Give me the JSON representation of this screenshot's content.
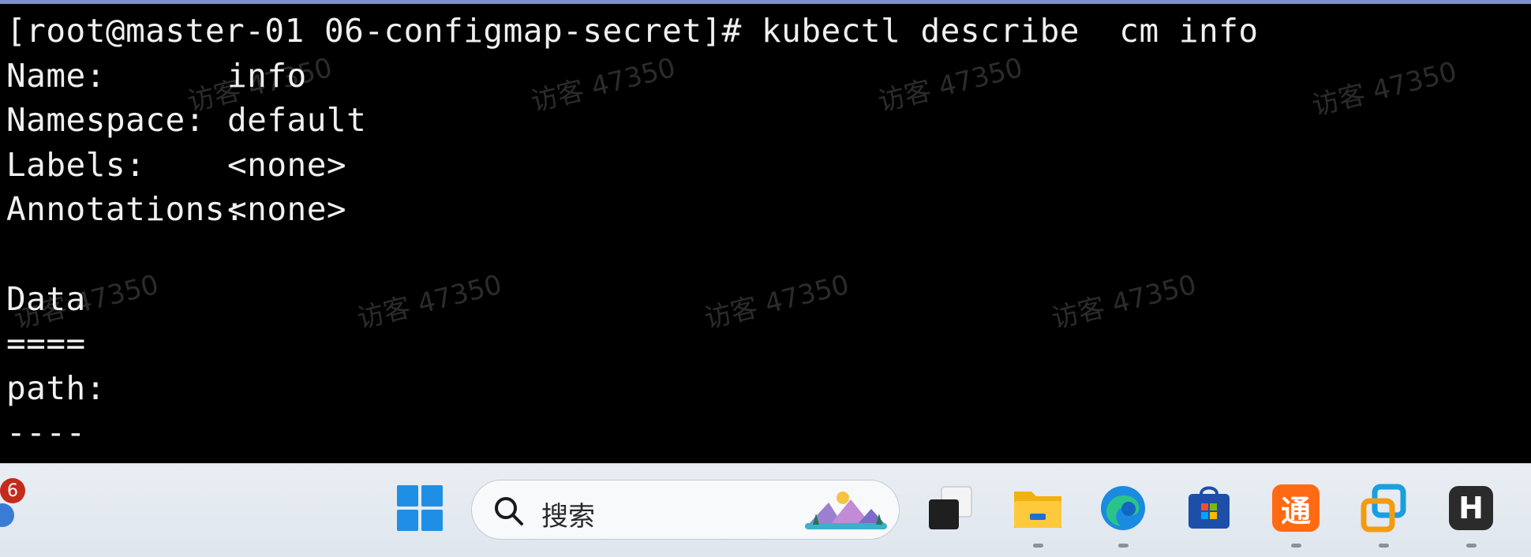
{
  "terminal": {
    "prompt": "[root@master-01 06-configmap-secret]# kubectl describe  cm info",
    "fields": [
      {
        "label": "Name:",
        "value": "info"
      },
      {
        "label": "Namespace:",
        "value": "default"
      },
      {
        "label": "Labels:",
        "value": "<none>"
      },
      {
        "label": "Annotations:",
        "value": "<none>"
      }
    ],
    "data_heading": "Data",
    "data_rule": "====",
    "key_label": "path:",
    "key_rule": "----",
    "watermark": "访客 47350"
  },
  "taskbar": {
    "notification_count": "6",
    "search_placeholder": "搜索",
    "store_icon_text": "通",
    "h_icon_text": "H",
    "icons": [
      "windows-start-icon",
      "search-icon",
      "landscape-icon",
      "task-view-icon",
      "file-explorer-icon",
      "edge-browser-icon",
      "microsoft-store-icon",
      "tong-app-icon",
      "vmware-icon",
      "h-app-icon"
    ]
  }
}
